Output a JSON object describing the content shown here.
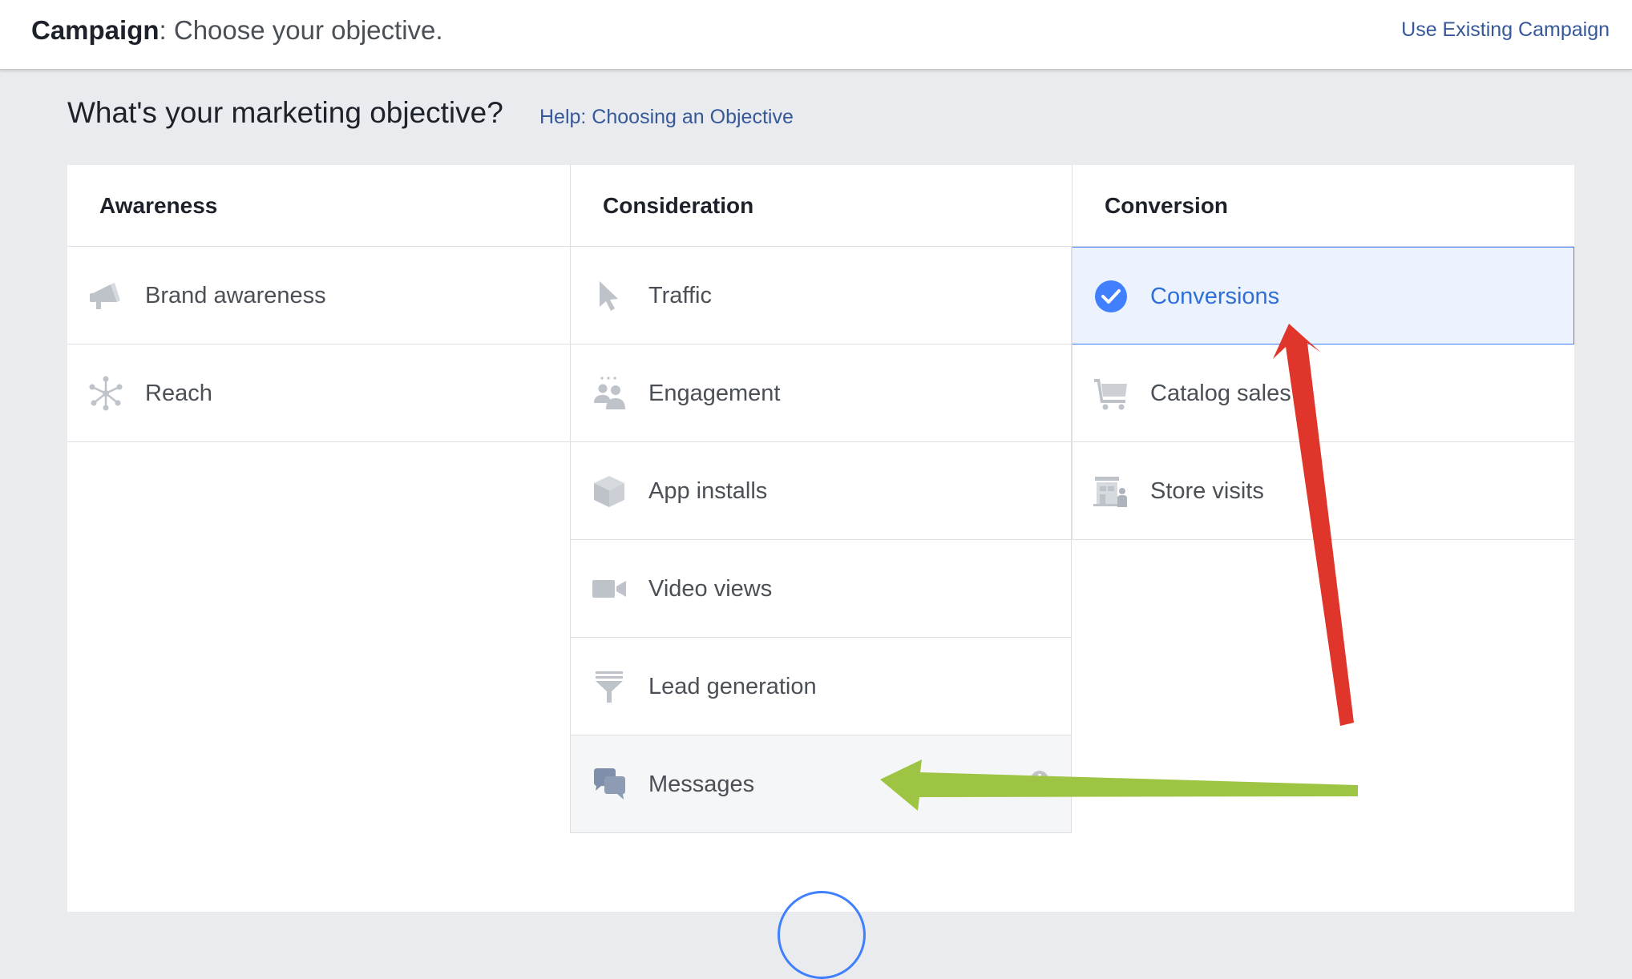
{
  "topbar": {
    "title_bold": "Campaign",
    "title_rest": ": Choose your objective.",
    "use_existing_label": "Use Existing Campaign"
  },
  "heading": {
    "question": "What's your marketing objective?",
    "help_link": "Help: Choosing an Objective"
  },
  "columns": [
    {
      "title": "Awareness",
      "items": [
        {
          "label": "Brand awareness",
          "icon": "megaphone-icon"
        },
        {
          "label": "Reach",
          "icon": "reach-icon"
        }
      ]
    },
    {
      "title": "Consideration",
      "items": [
        {
          "label": "Traffic",
          "icon": "cursor-icon"
        },
        {
          "label": "Engagement",
          "icon": "people-icon"
        },
        {
          "label": "App installs",
          "icon": "box-icon"
        },
        {
          "label": "Video views",
          "icon": "video-camera-icon"
        },
        {
          "label": "Lead generation",
          "icon": "funnel-icon"
        },
        {
          "label": "Messages",
          "icon": "chat-bubbles-icon"
        }
      ]
    },
    {
      "title": "Conversion",
      "items": [
        {
          "label": "Conversions",
          "icon": "checkmark-circle-icon",
          "selected": true
        },
        {
          "label": "Catalog sales",
          "icon": "cart-icon"
        },
        {
          "label": "Store visits",
          "icon": "store-icon"
        }
      ]
    }
  ],
  "colors": {
    "selected_bg": "#ecf3fe",
    "selected_border": "#4080ff",
    "link": "#365899",
    "annotation_red": "#e0352b",
    "annotation_green": "#9dc443"
  }
}
